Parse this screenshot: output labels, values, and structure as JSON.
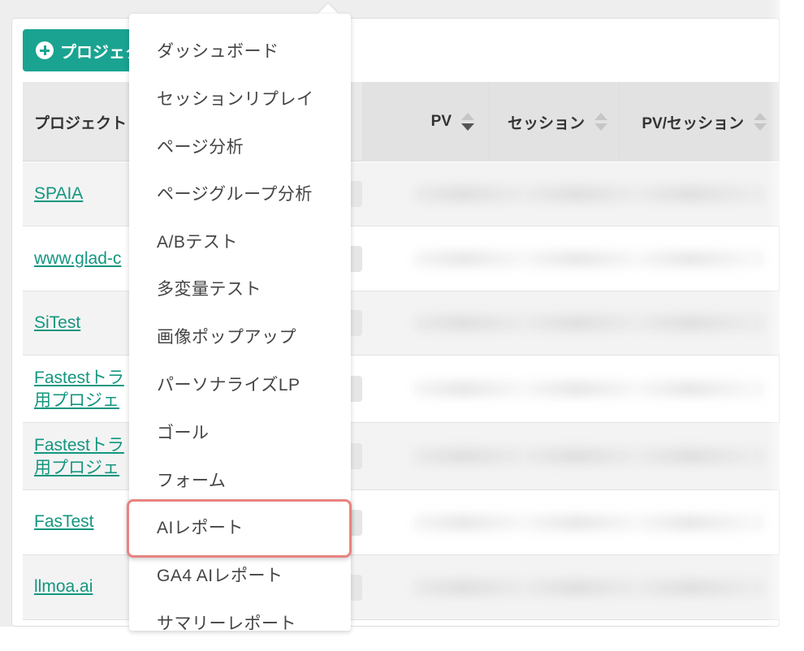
{
  "toolbar": {
    "add_project_label": "プロジェクト"
  },
  "table": {
    "columns": [
      "プロジェクト",
      "PV",
      "セッション",
      "PV/セッション"
    ],
    "rows": [
      {
        "name": "SPAIA"
      },
      {
        "name": "www.glad-c"
      },
      {
        "name": "SiTest"
      },
      {
        "name": "Fastestトラ",
        "name_line2": "用プロジェ"
      },
      {
        "name": "Fastestトラ",
        "name_line2": "用プロジェ"
      },
      {
        "name": "FasTest"
      },
      {
        "name": "llmoa.ai"
      }
    ]
  },
  "menu": {
    "items": [
      "ダッシュボード",
      "セッションリプレイ",
      "ページ分析",
      "ページグループ分析",
      "A/Bテスト",
      "多変量テスト",
      "画像ポップアップ",
      "パーソナライズLP",
      "ゴール",
      "フォーム",
      "AIレポート",
      "GA4 AIレポート",
      "サマリーレポート"
    ],
    "highlighted": "AIレポート"
  },
  "colors": {
    "accent": "#1aa391",
    "link": "#14967f",
    "highlight_border": "#e8837f"
  }
}
